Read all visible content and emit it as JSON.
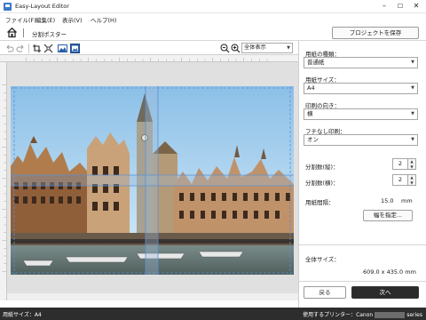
{
  "window": {
    "title": "Easy-Layout Editor",
    "minimize": "–",
    "maximize": "☐",
    "close": "✕"
  },
  "menu": {
    "items": [
      "ファイル(F)",
      "編集(E)",
      "表示(V)",
      "ヘルプ(H)"
    ]
  },
  "nav": {
    "home_icon": "home-icon",
    "breadcrumb": "分割ポスター",
    "save_button": "プロジェクトを保存"
  },
  "toolbar": {
    "icons": [
      "undo-icon",
      "redo-icon",
      "crop-icon",
      "fit-icon",
      "image-icon",
      "image-frame-icon"
    ],
    "zoom_out_icon": "zoom-out-icon",
    "zoom_in_icon": "zoom-in-icon",
    "zoom_value": "全体表示"
  },
  "panel": {
    "paper_type_label": "用紙の種類：",
    "paper_type_value": "普通紙",
    "paper_size_label": "用紙サイズ：",
    "paper_size_value": "A4",
    "orientation_label": "印刷の向き：",
    "orientation_value": "横",
    "borderless_label": "フチなし印刷：",
    "borderless_value": "オン",
    "split_vertical_label": "分割数(縦)：",
    "split_vertical_value": "2",
    "split_horizontal_label": "分割数(横)：",
    "split_horizontal_value": "2",
    "paper_spacing_label": "用紙間隔：",
    "paper_spacing_value": "15.0",
    "paper_spacing_unit": "mm",
    "overlap_button": "幅を指定...",
    "total_size_label": "全体サイズ：",
    "total_size_value": "609.0 x 435.0 mm"
  },
  "footer": {
    "back_button": "戻る",
    "next_button": "次へ"
  },
  "status": {
    "paper_size": "用紙サイズ：A4",
    "printer_prefix": "使用するプリンター：Canon",
    "printer_suffix": "series"
  },
  "colors": {
    "accent": "#2b2b2b",
    "guide": "#5b8fd1",
    "status_bg": "#2d2d2d"
  }
}
